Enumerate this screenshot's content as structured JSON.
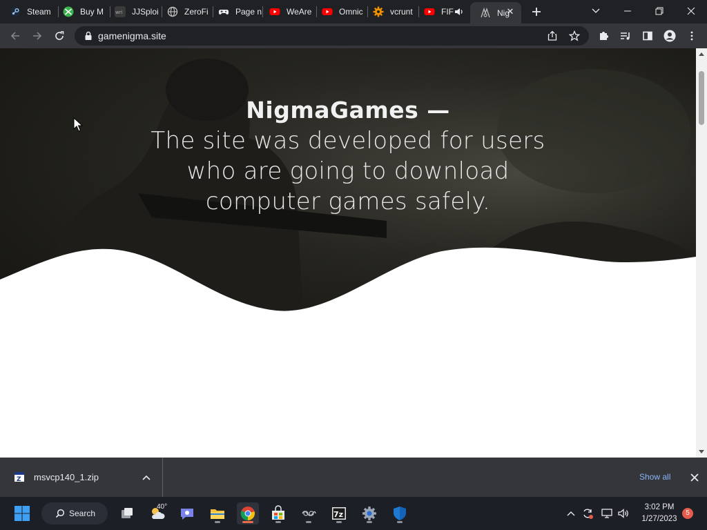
{
  "browser": {
    "tabs": [
      {
        "title": "Steam",
        "icon": "steam-icon",
        "color": "#9fc5e8"
      },
      {
        "title": "Buy M",
        "icon": "xbox-icon",
        "color": "#38b34a"
      },
      {
        "title": "JJSploi",
        "icon": "jjsploit-icon",
        "color": "#888888"
      },
      {
        "title": "ZeroFi",
        "icon": "globe-icon",
        "color": "#bdbdbd"
      },
      {
        "title": "Page n",
        "icon": "gamepad-icon",
        "color": "#e8eaed"
      },
      {
        "title": "WeAre",
        "icon": "youtube-icon",
        "color": "#ff0000"
      },
      {
        "title": "Omnic",
        "icon": "youtube-icon",
        "color": "#ff0000"
      },
      {
        "title": "vcrunt",
        "icon": "gear-orange-icon",
        "color": "#f29100"
      },
      {
        "title": "FIF",
        "icon": "youtube-icon",
        "color": "#ff0000"
      },
      {
        "title": "Nig",
        "icon": "nigma-icon",
        "color": "#bdbdbd"
      }
    ],
    "active_tab_index": 9,
    "address": "gamenigma.site"
  },
  "page": {
    "brand": "NigmaGames —",
    "tagline": "The site was developed for users who are going to download computer games safely."
  },
  "downloads": {
    "file_name": "msvcp140_1.zip",
    "show_all": "Show all"
  },
  "taskbar": {
    "search_label": "Search",
    "weather_temp": "40°",
    "time": "3:02 PM",
    "date": "1/27/2023",
    "notification_count": "5"
  },
  "colors": {
    "tab_strip": "#202124",
    "toolbar": "#35363a",
    "hero_text": "#f1f1f1",
    "link": "#8ab4f8",
    "taskbar": "#1c1f26"
  }
}
